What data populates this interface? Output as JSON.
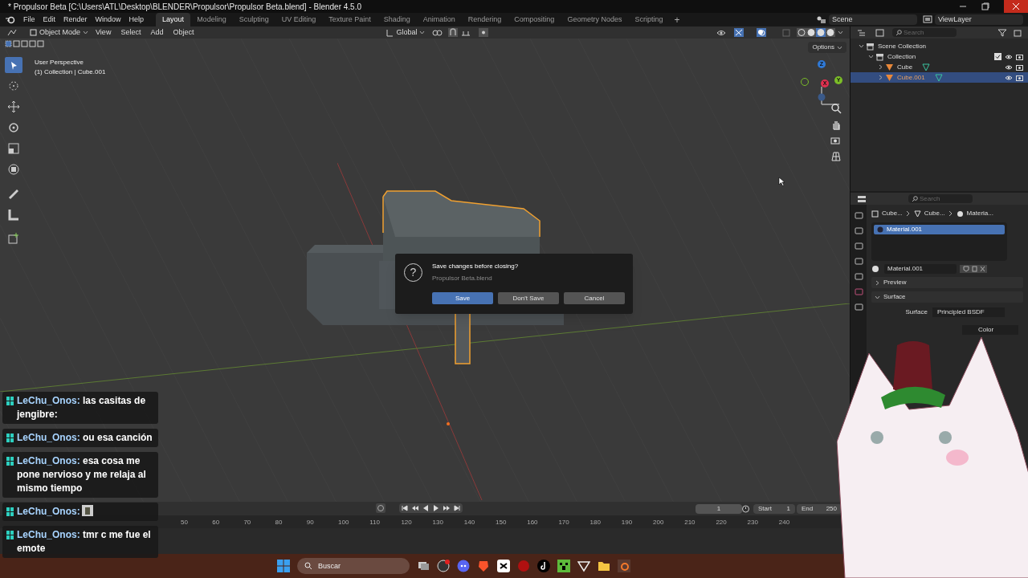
{
  "window": {
    "title": "* Propulsor Beta [C:\\Users\\ATL\\Desktop\\BLENDER\\Propulsor\\Propulsor Beta.blend] - Blender 4.5.0"
  },
  "menu": [
    "File",
    "Edit",
    "Render",
    "Window",
    "Help"
  ],
  "workspaces": [
    {
      "label": "Layout",
      "selected": true
    },
    {
      "label": "Modeling",
      "selected": false
    },
    {
      "label": "Sculpting",
      "selected": false
    },
    {
      "label": "UV Editing",
      "selected": false
    },
    {
      "label": "Texture Paint",
      "selected": false
    },
    {
      "label": "Shading",
      "selected": false
    },
    {
      "label": "Animation",
      "selected": false
    },
    {
      "label": "Rendering",
      "selected": false
    },
    {
      "label": "Compositing",
      "selected": false
    },
    {
      "label": "Geometry Nodes",
      "selected": false
    },
    {
      "label": "Scripting",
      "selected": false
    }
  ],
  "add_workspace": "+",
  "scene": {
    "scene": "Scene",
    "view_layer": "ViewLayer"
  },
  "viewport_header": {
    "mode": "Object Mode",
    "menus": [
      "View",
      "Select",
      "Add",
      "Object"
    ],
    "orientation": "Global",
    "options": "Options"
  },
  "viewport": {
    "info": [
      "User Perspective",
      "(1) Collection | Cube.001"
    ],
    "gizmo": [
      "Z",
      "Y",
      "X"
    ]
  },
  "outliner": {
    "search_placeholder": "Search",
    "items": [
      {
        "label": "Scene Collection",
        "kind": "scene",
        "selected": false,
        "children": [
          {
            "label": "Collection",
            "kind": "collection",
            "selected": false,
            "checked": true,
            "children": [
              {
                "label": "Cube",
                "kind": "object",
                "selected": false
              },
              {
                "label": "Cube.001",
                "kind": "object",
                "selected": true
              }
            ]
          }
        ]
      }
    ]
  },
  "properties": {
    "search_placeholder": "Search",
    "breadcrumb": [
      "Cube...",
      "Cube...",
      "Materia..."
    ],
    "slots": [
      {
        "label": "Material.001",
        "selected": true
      }
    ],
    "material_name": "Material.001",
    "panels": [
      {
        "label": "Preview",
        "expanded": false
      },
      {
        "label": "Surface",
        "expanded": true
      }
    ],
    "surface_label": "Surface",
    "surface_value": "Principled BSDF",
    "color_field": "Color"
  },
  "dialog": {
    "icon": "?",
    "title": "Save changes before closing?",
    "file": "Propulsor Beta.blend",
    "buttons": [
      {
        "label": "Save",
        "selected": true
      },
      {
        "label": "Don't Save",
        "selected": false
      },
      {
        "label": "Cancel",
        "selected": false
      }
    ]
  },
  "timeline": {
    "current_frame": "1",
    "start_label": "Start",
    "start": "1",
    "end_label": "End",
    "end": "250",
    "ticks": [
      "50",
      "60",
      "70",
      "80",
      "90",
      "100",
      "110",
      "120",
      "130",
      "140",
      "150",
      "160",
      "170",
      "180",
      "190",
      "200",
      "210",
      "220",
      "230",
      "240"
    ]
  },
  "chat": [
    {
      "kind": "text",
      "user": "LeChu_Onos:",
      "text": "las casitas de jengibre:"
    },
    {
      "kind": "text",
      "user": "LeChu_Onos:",
      "text": "ou esa canción"
    },
    {
      "kind": "text",
      "user": "LeChu_Onos:",
      "text": "esa cosa me pone nervioso y me relaja al mismo tiempo"
    },
    {
      "kind": "emote",
      "user": "LeChu_Onos:"
    },
    {
      "kind": "text",
      "user": "LeChu_Onos:",
      "text": "tmr c me fue el emote"
    }
  ],
  "taskbar": {
    "search_placeholder": "Buscar"
  }
}
